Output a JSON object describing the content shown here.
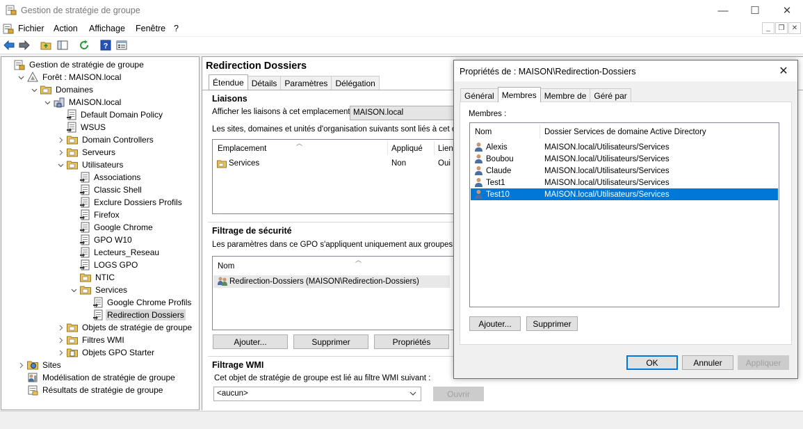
{
  "window": {
    "title": "Gestion de stratégie de groupe",
    "minimize": "—",
    "maximize": "☐",
    "close": "✕"
  },
  "menu": {
    "items": [
      "Fichier",
      "Action",
      "Affichage",
      "Fenêtre",
      "?"
    ]
  },
  "toolbar": {
    "icons": [
      "back-arrow-icon",
      "forward-arrow-icon",
      "folder-up-icon",
      "show-hide-tree-icon",
      "refresh-icon",
      "help-icon",
      "properties-icon"
    ]
  },
  "tree": {
    "root": "Gestion de stratégie de groupe",
    "forest": "Forêt : MAISON.local",
    "domains": "Domaines",
    "domain": "MAISON.local",
    "gpo_default": "Default Domain Policy",
    "gpo_wsus": "WSUS",
    "ou_dc": "Domain Controllers",
    "ou_servers": "Serveurs",
    "ou_users": "Utilisateurs",
    "user_gpos": [
      "Associations",
      "Classic Shell",
      "Exclure Dossiers Profils",
      "Firefox",
      "Google Chrome",
      "GPO W10",
      "Lecteurs_Reseau",
      "LOGS GPO"
    ],
    "ou_ntic": "NTIC",
    "ou_services": "Services",
    "services_gpos": [
      "Google Chrome Profils",
      "Redirection Dossiers"
    ],
    "gpo_objects": "Objets de stratégie de groupe",
    "wmi_filters": "Filtres WMI",
    "starter_gpos": "Objets GPO Starter",
    "sites": "Sites",
    "modeling": "Modélisation de stratégie de groupe",
    "results": "Résultats de stratégie de groupe"
  },
  "right": {
    "title": "Redirection Dossiers",
    "tabs": [
      "Étendue",
      "Détails",
      "Paramètres",
      "Délégation"
    ],
    "links_heading": "Liaisons",
    "links_label": "Afficher les liaisons à cet emplacement :",
    "links_location": "MAISON.local",
    "links_desc": "Les sites, domaines et unités d'organisation suivants sont liés à cet objet G",
    "links_columns": [
      "Emplacement",
      "Appliqué",
      "Lien"
    ],
    "links_rows": [
      {
        "location": "Services",
        "enforced": "Non",
        "enabled": "Oui"
      }
    ],
    "security_heading": "Filtrage de sécurité",
    "security_desc": "Les paramètres dans ce GPO s'appliquent uniquement aux groupes, utilisa",
    "security_column": "Nom",
    "security_rows": [
      "Redirection-Dossiers (MAISON\\Redirection-Dossiers)"
    ],
    "buttons": [
      "Ajouter...",
      "Supprimer",
      "Propriétés"
    ],
    "wmi_heading": "Filtrage WMI",
    "wmi_desc": "Cet objet de stratégie de groupe est lié au filtre WMI suivant :",
    "wmi_value": "<aucun>",
    "wmi_open": "Ouvrir"
  },
  "dialog": {
    "title": "Propriétés de : MAISON\\Redirection-Dossiers",
    "tabs": [
      "Général",
      "Membres",
      "Membre de",
      "Géré par"
    ],
    "members_label": "Membres :",
    "columns": [
      "Nom",
      "Dossier Services de domaine Active Directory"
    ],
    "members": [
      {
        "name": "Alexis",
        "path": "MAISON.local/Utilisateurs/Services"
      },
      {
        "name": "Boubou",
        "path": "MAISON.local/Utilisateurs/Services"
      },
      {
        "name": "Claude",
        "path": "MAISON.local/Utilisateurs/Services"
      },
      {
        "name": "Test1",
        "path": "MAISON.local/Utilisateurs/Services"
      },
      {
        "name": "Test10",
        "path": "MAISON.local/Utilisateurs/Services"
      }
    ],
    "add": "Ajouter...",
    "remove": "Supprimer",
    "ok": "OK",
    "cancel": "Annuler",
    "apply": "Appliquer"
  },
  "colors": {
    "selection": "#0078d7",
    "folder": "#e8c35a",
    "user_icon": "#4a6fa5"
  }
}
